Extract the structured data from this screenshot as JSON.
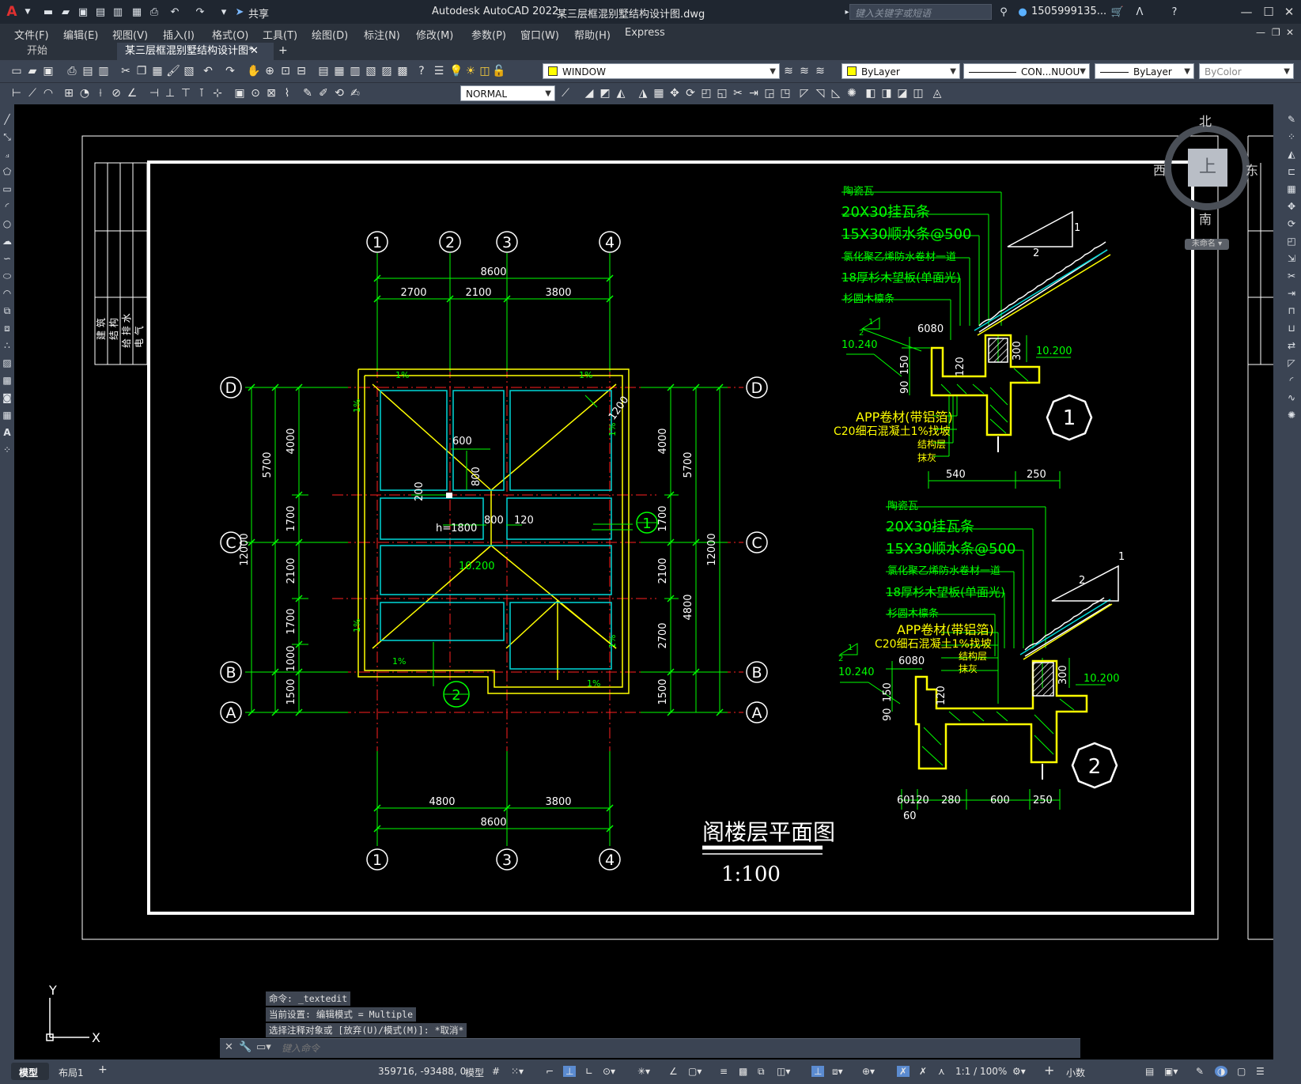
{
  "app": {
    "title": "Autodesk AutoCAD 2022",
    "filename": "某三层框混别墅结构设计图.dwg",
    "share": "共享",
    "search_placeholder": "键入关键字或短语",
    "user": "1505999135...",
    "logo": "A"
  },
  "menu": [
    "文件(F)",
    "编辑(E)",
    "视图(V)",
    "插入(I)",
    "格式(O)",
    "工具(T)",
    "绘图(D)",
    "标注(N)",
    "修改(M)",
    "参数(P)",
    "窗口(W)",
    "帮助(H)",
    "Express"
  ],
  "tabs": [
    {
      "label": "开始",
      "active": false
    },
    {
      "label": "某三层框混别墅结构设计图*",
      "active": true
    }
  ],
  "toolbar": {
    "layer_state": "WINDOW",
    "color": "ByLayer",
    "linetype": "CON...NUOU",
    "lineweight": "ByLayer",
    "plotstyle": "ByColor",
    "textstyle": "NORMAL"
  },
  "viewcube": {
    "north": "北",
    "south": "南",
    "east": "东",
    "west": "西",
    "face": "上",
    "wcs": "未命名"
  },
  "title_block": [
    "建 筑",
    "结 构",
    "给 排 水",
    "电 气"
  ],
  "plan": {
    "axes_top": [
      "1",
      "2",
      "3",
      "4"
    ],
    "axes_bottom": [
      "1",
      "3",
      "4"
    ],
    "axes_side": [
      "D",
      "C",
      "B",
      "A"
    ],
    "dims_top_total": "8600",
    "dims_top": [
      "2700",
      "2100",
      "3800"
    ],
    "dims_bottom": [
      "4800",
      "3800"
    ],
    "dims_bottom_total": "8600",
    "dims_left_outer": [
      "5700",
      "12000"
    ],
    "dims_left": [
      "4000",
      "1700",
      "2100",
      "1700",
      "1000",
      "1500"
    ],
    "dims_right": [
      "4000",
      "1700",
      "2100",
      "2700",
      "1500"
    ],
    "dims_right_outer": [
      "5700",
      "4800",
      "12000"
    ],
    "labels": {
      "d600": "600",
      "d800": "800",
      "d200": "200",
      "d800b": "800",
      "d120": "120",
      "h": "h=1800",
      "elev": "10.200",
      "d1200": "1200",
      "slope": "1%",
      "sec1": "1",
      "sec2": "2"
    },
    "title": "阁楼层平面图",
    "scale": "1:100"
  },
  "detail1": {
    "layers": [
      "陶瓷瓦",
      "20X30挂瓦条",
      "15X30顺水条@500",
      "氯化聚乙烯防水卷材一道",
      "18厚杉木望板(单面光)",
      "杉圆木檩条"
    ],
    "bottom_layers": [
      "APP卷材(带铝箔)",
      "C20细石混凝土1%找坡",
      "结构层",
      "抹灰"
    ],
    "dims": {
      "d6080": "6080",
      "d120": "120",
      "d300": "300",
      "d90": "90",
      "d150": "150",
      "d540": "540",
      "d250": "250"
    },
    "elev_left": "10.240",
    "elev_right": "10.200",
    "slope_v": "1",
    "slope_h": "2",
    "tag": "1",
    "slope_small_v": "1",
    "slope_small_h": "2"
  },
  "detail2": {
    "layers": [
      "陶瓷瓦",
      "20X30挂瓦条",
      "15X30顺水条@500",
      "氯化聚乙烯防水卷材一道",
      "18厚杉木望板(单面光)",
      "杉圆木檩条"
    ],
    "bottom_layers": [
      "APP卷材(带铝箔)",
      "C20细石混凝土1%找坡",
      "结构层",
      "抹灰"
    ],
    "dims": {
      "d6080": "6080",
      "d120": "120",
      "d300": "300",
      "d90": "90",
      "d150": "150",
      "d60a": "60",
      "d120b": "120",
      "d280": "280",
      "d600": "600",
      "d250": "250",
      "d60b": "60"
    },
    "elev_left": "10.240",
    "elev_right": "10.200",
    "slope_v": "1",
    "slope_h": "2",
    "tag": "2",
    "slope_small_v": "1",
    "slope_small_h": "2"
  },
  "ucs": {
    "y": "Y",
    "x": "X"
  },
  "command": {
    "history": [
      "命令: _textedit",
      "当前设置: 编辑模式 = Multiple",
      "选择注释对象或 [放弃(U)/模式(M)]: *取消*"
    ],
    "placeholder": "键入命令"
  },
  "status": {
    "layout_tabs": [
      "模型",
      "布局1"
    ],
    "coords": "359716, -93488, 0",
    "space": "模型",
    "scale": "1:1 / 100%",
    "units": "小数"
  },
  "colors": {
    "green": "#00ff00",
    "yellow": "#ffff00",
    "cyan": "#00d8d8",
    "red": "#ff2020",
    "white": "#ffffff"
  }
}
